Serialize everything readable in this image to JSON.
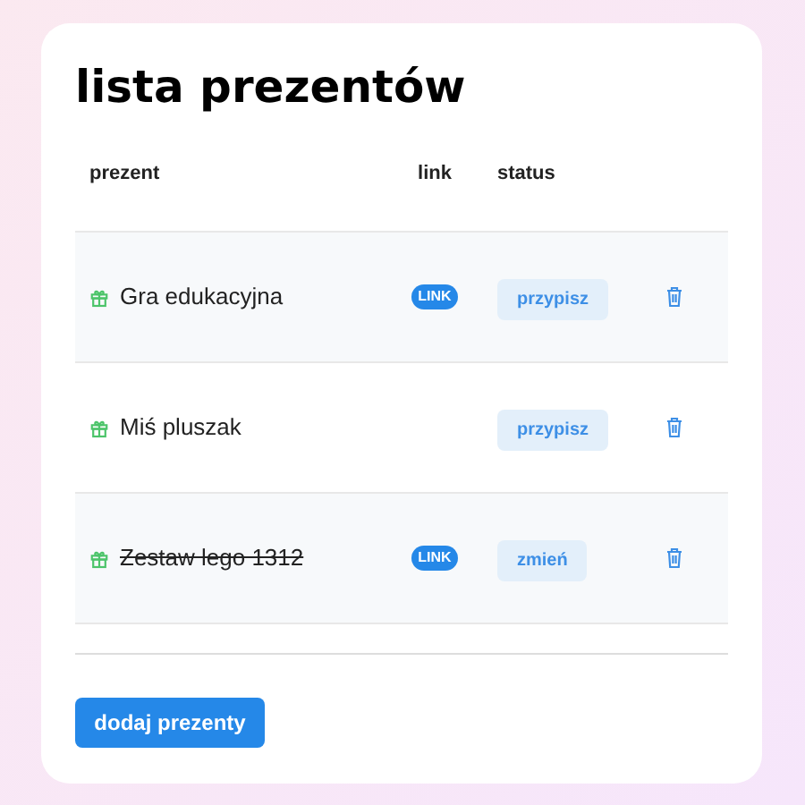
{
  "title": "lista prezentów",
  "table": {
    "columns": [
      "prezent",
      "link",
      "status"
    ],
    "rows": [
      {
        "name": "Gra edukacyjna",
        "link": "LINK",
        "status": "przypisz",
        "struck": false
      },
      {
        "name": "Miś pluszak",
        "status": "przypisz",
        "struck": false
      },
      {
        "name": "Zestaw lego 1312",
        "link": "LINK",
        "status": "zmień",
        "struck": true
      }
    ]
  },
  "button": "dodaj prezenty"
}
